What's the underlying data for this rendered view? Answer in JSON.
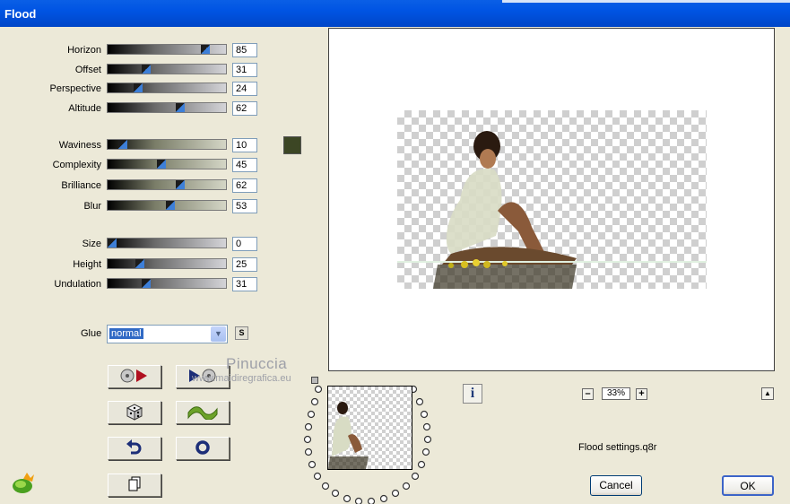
{
  "window": {
    "title": "Flood"
  },
  "sliders": [
    {
      "label": "Horizon",
      "value": "85",
      "style": "gray"
    },
    {
      "label": "Offset",
      "value": "31",
      "style": "gray"
    },
    {
      "label": "Perspective",
      "value": "24",
      "style": "gray"
    },
    {
      "label": "Altitude",
      "value": "62",
      "style": "gray"
    },
    {
      "label": "Waviness",
      "value": "10",
      "style": "olive"
    },
    {
      "label": "Complexity",
      "value": "45",
      "style": "olive"
    },
    {
      "label": "Brilliance",
      "value": "62",
      "style": "olive"
    },
    {
      "label": "Blur",
      "value": "53",
      "style": "olive"
    },
    {
      "label": "Size",
      "value": "0",
      "style": "gray"
    },
    {
      "label": "Height",
      "value": "25",
      "style": "gray"
    },
    {
      "label": "Undulation",
      "value": "31",
      "style": "gray"
    }
  ],
  "color_swatch": {
    "color": "#3c4624"
  },
  "glue": {
    "label": "Glue",
    "value": "normal",
    "s_button": "S"
  },
  "watermark": {
    "name": "Pinuccia",
    "url": "www.maidiregrafica.eu"
  },
  "preview": {
    "zoom": "33%"
  },
  "settings_file": "Flood settings.q8r",
  "buttons": {
    "cancel": "Cancel",
    "ok": "OK"
  },
  "icons": {
    "load": "load-preset-icon",
    "save": "save-preset-icon",
    "random": "dice-icon",
    "wave": "wave-icon",
    "undo": "undo-icon",
    "reset": "reset-circle-icon",
    "copy": "copy-icon",
    "info": "info-icon"
  }
}
